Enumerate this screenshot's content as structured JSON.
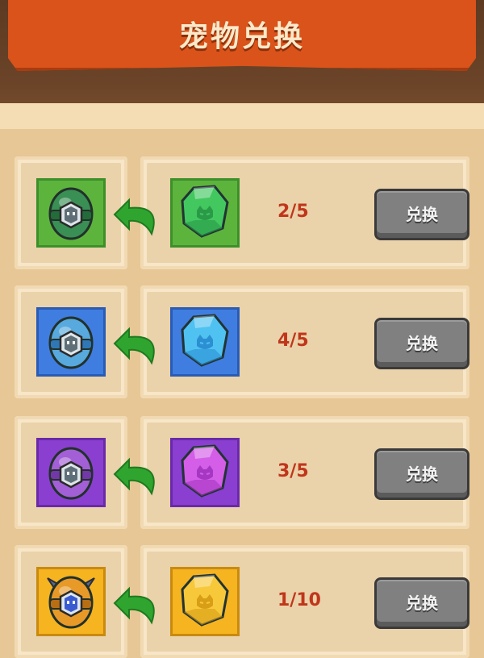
{
  "header": {
    "title": "宠物兑换"
  },
  "rows": [
    {
      "progress": "2/5",
      "button_label": "兑换",
      "theme": "green",
      "colors": {
        "tile": "#5db43d",
        "tile_border": "#3d8f2a",
        "egg": "#3a8f55",
        "egg_dark": "#236b3a",
        "gem": "#43c860",
        "gem_dark": "#2a9a48"
      }
    },
    {
      "progress": "4/5",
      "button_label": "兑换",
      "theme": "blue",
      "colors": {
        "tile": "#3f7ee0",
        "tile_border": "#2a5bb5",
        "egg": "#58a9dd",
        "egg_dark": "#2f78b5",
        "gem": "#4fc2f2",
        "gem_dark": "#2c8fd2"
      }
    },
    {
      "progress": "3/5",
      "button_label": "兑换",
      "theme": "purple",
      "colors": {
        "tile": "#8a3fd1",
        "tile_border": "#6a2aa8",
        "egg": "#a35fd6",
        "egg_dark": "#7338a8",
        "gem": "#d45ee8",
        "gem_dark": "#a537c2"
      }
    },
    {
      "progress": "1/10",
      "button_label": "兑换",
      "theme": "gold",
      "colors": {
        "tile": "#f5b420",
        "tile_border": "#c98a10",
        "egg": "#e89a28",
        "egg_dark": "#b86f14",
        "gem": "#f7c93a",
        "gem_dark": "#d89e16"
      }
    }
  ],
  "colors": {
    "banner": "#d9531a",
    "arrow": "#2fa52f",
    "count_text": "#c0361b",
    "button": "#808080"
  },
  "icons": {
    "egg": "pet-egg-icon",
    "gem": "soul-crystal-icon",
    "arrow": "green-exchange-arrow-icon"
  }
}
